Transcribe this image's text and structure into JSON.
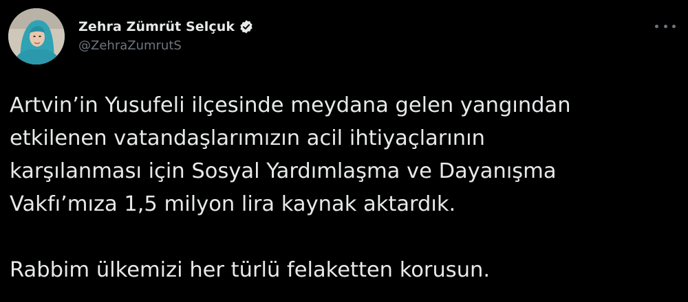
{
  "author": {
    "display_name": "Zehra Zümrüt Selçuk",
    "handle": "@ZehraZumrutS",
    "verified": true
  },
  "icons": {
    "avatar": "profile-photo",
    "verified": "verified-badge-icon",
    "more": "more-options-icon"
  },
  "tweet": {
    "lines": [
      "Artvin’in Yusufeli ilçesinde meydana gelen yangından",
      "etkilenen vatandaşlarımızın acil ihtiyaçlarının",
      "karşılanması için Sosyal Yardımlaşma ve Dayanışma",
      "Vakfı’mıza 1,5 milyon lira kaynak aktardık."
    ],
    "closing": "Rabbim ülkemizi her türlü felaketten korusun."
  },
  "colors": {
    "background": "#000000",
    "text": "#e7e9ea",
    "secondary": "#6e767d"
  }
}
